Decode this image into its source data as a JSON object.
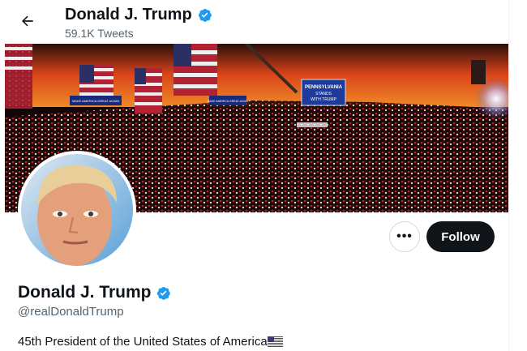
{
  "header": {
    "display_name": "Donald J. Trump",
    "tweet_count": "59.1K Tweets",
    "back_icon": "arrow-left-icon"
  },
  "banner": {
    "sign_text_line1": "PENNSYLVANIA",
    "sign_text_line2": "STANDS",
    "sign_text_line3": "WITH TRUMP",
    "small_sign_1": "MAKE AMERICA GREAT AGAIN",
    "small_sign_2": "MAKE AMERICA GREAT AGAIN"
  },
  "profile": {
    "name": "Donald J. Trump",
    "handle": "@realDonaldTrump",
    "bio": "45th President of the United States of America",
    "bio_emoji_icon": "us-flag-icon",
    "verified_icon": "verified-badge-icon"
  },
  "actions": {
    "more_label": "•••",
    "follow_label": "Follow"
  },
  "colors": {
    "verified": "#1d9bf0",
    "follow_bg": "#0f1419",
    "secondary_text": "#536471"
  }
}
